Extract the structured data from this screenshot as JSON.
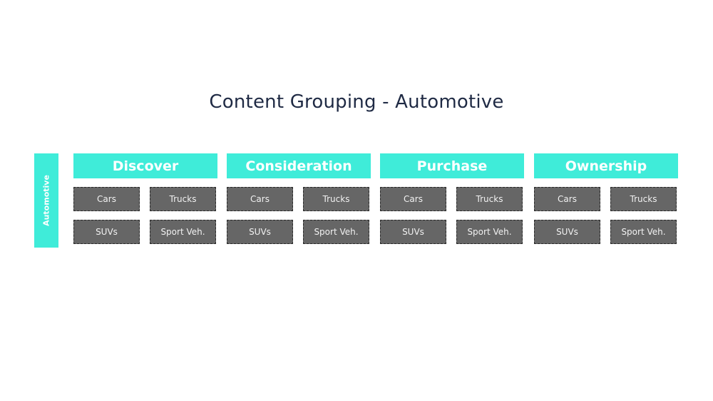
{
  "title": "Content Grouping - Automotive",
  "side_label": "Automotive",
  "colors": {
    "accent": "#3fecd9",
    "cell": "#666666",
    "title": "#1f2a44"
  },
  "stages": [
    {
      "label": "Discover",
      "items": [
        "Cars",
        "Trucks",
        "SUVs",
        "Sport Veh."
      ]
    },
    {
      "label": "Consideration",
      "items": [
        "Cars",
        "Trucks",
        "SUVs",
        "Sport Veh."
      ]
    },
    {
      "label": "Purchase",
      "items": [
        "Cars",
        "Trucks",
        "SUVs",
        "Sport Veh."
      ]
    },
    {
      "label": "Ownership",
      "items": [
        "Cars",
        "Trucks",
        "SUVs",
        "Sport Veh."
      ]
    }
  ]
}
